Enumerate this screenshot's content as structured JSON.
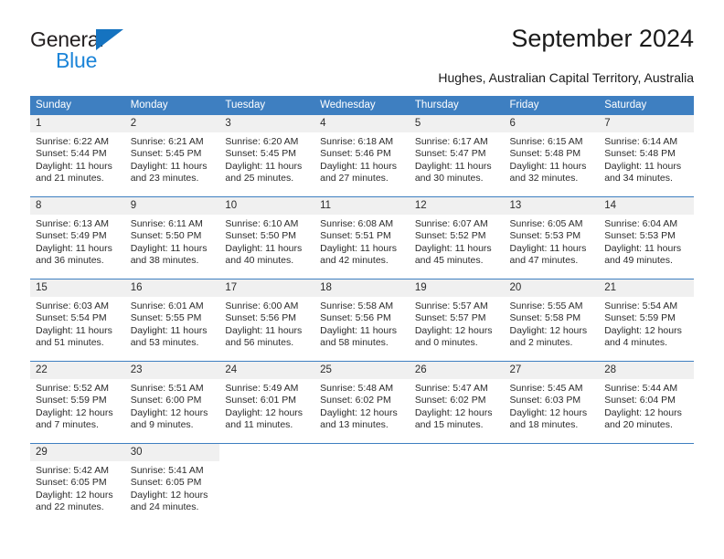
{
  "brand": {
    "name_top": "General",
    "name_bottom": "Blue",
    "triangle_color": "#1573c0",
    "text_color": "#231f20",
    "blue_text_color": "#1b84d8"
  },
  "header": {
    "title": "September 2024",
    "subtitle": "Hughes, Australian Capital Territory, Australia"
  },
  "theme": {
    "header_bg": "#3e7fc1",
    "header_text": "#ffffff",
    "daynum_bg": "#f0f0f0",
    "body_text": "#2b2b2b",
    "row_border": "#3e7fc1"
  },
  "calendar": {
    "weekday_headers": [
      "Sunday",
      "Monday",
      "Tuesday",
      "Wednesday",
      "Thursday",
      "Friday",
      "Saturday"
    ],
    "weeks": [
      [
        {
          "day": "1",
          "sunrise": "Sunrise: 6:22 AM",
          "sunset": "Sunset: 5:44 PM",
          "daylight_line1": "Daylight: 11 hours",
          "daylight_line2": "and 21 minutes."
        },
        {
          "day": "2",
          "sunrise": "Sunrise: 6:21 AM",
          "sunset": "Sunset: 5:45 PM",
          "daylight_line1": "Daylight: 11 hours",
          "daylight_line2": "and 23 minutes."
        },
        {
          "day": "3",
          "sunrise": "Sunrise: 6:20 AM",
          "sunset": "Sunset: 5:45 PM",
          "daylight_line1": "Daylight: 11 hours",
          "daylight_line2": "and 25 minutes."
        },
        {
          "day": "4",
          "sunrise": "Sunrise: 6:18 AM",
          "sunset": "Sunset: 5:46 PM",
          "daylight_line1": "Daylight: 11 hours",
          "daylight_line2": "and 27 minutes."
        },
        {
          "day": "5",
          "sunrise": "Sunrise: 6:17 AM",
          "sunset": "Sunset: 5:47 PM",
          "daylight_line1": "Daylight: 11 hours",
          "daylight_line2": "and 30 minutes."
        },
        {
          "day": "6",
          "sunrise": "Sunrise: 6:15 AM",
          "sunset": "Sunset: 5:48 PM",
          "daylight_line1": "Daylight: 11 hours",
          "daylight_line2": "and 32 minutes."
        },
        {
          "day": "7",
          "sunrise": "Sunrise: 6:14 AM",
          "sunset": "Sunset: 5:48 PM",
          "daylight_line1": "Daylight: 11 hours",
          "daylight_line2": "and 34 minutes."
        }
      ],
      [
        {
          "day": "8",
          "sunrise": "Sunrise: 6:13 AM",
          "sunset": "Sunset: 5:49 PM",
          "daylight_line1": "Daylight: 11 hours",
          "daylight_line2": "and 36 minutes."
        },
        {
          "day": "9",
          "sunrise": "Sunrise: 6:11 AM",
          "sunset": "Sunset: 5:50 PM",
          "daylight_line1": "Daylight: 11 hours",
          "daylight_line2": "and 38 minutes."
        },
        {
          "day": "10",
          "sunrise": "Sunrise: 6:10 AM",
          "sunset": "Sunset: 5:50 PM",
          "daylight_line1": "Daylight: 11 hours",
          "daylight_line2": "and 40 minutes."
        },
        {
          "day": "11",
          "sunrise": "Sunrise: 6:08 AM",
          "sunset": "Sunset: 5:51 PM",
          "daylight_line1": "Daylight: 11 hours",
          "daylight_line2": "and 42 minutes."
        },
        {
          "day": "12",
          "sunrise": "Sunrise: 6:07 AM",
          "sunset": "Sunset: 5:52 PM",
          "daylight_line1": "Daylight: 11 hours",
          "daylight_line2": "and 45 minutes."
        },
        {
          "day": "13",
          "sunrise": "Sunrise: 6:05 AM",
          "sunset": "Sunset: 5:53 PM",
          "daylight_line1": "Daylight: 11 hours",
          "daylight_line2": "and 47 minutes."
        },
        {
          "day": "14",
          "sunrise": "Sunrise: 6:04 AM",
          "sunset": "Sunset: 5:53 PM",
          "daylight_line1": "Daylight: 11 hours",
          "daylight_line2": "and 49 minutes."
        }
      ],
      [
        {
          "day": "15",
          "sunrise": "Sunrise: 6:03 AM",
          "sunset": "Sunset: 5:54 PM",
          "daylight_line1": "Daylight: 11 hours",
          "daylight_line2": "and 51 minutes."
        },
        {
          "day": "16",
          "sunrise": "Sunrise: 6:01 AM",
          "sunset": "Sunset: 5:55 PM",
          "daylight_line1": "Daylight: 11 hours",
          "daylight_line2": "and 53 minutes."
        },
        {
          "day": "17",
          "sunrise": "Sunrise: 6:00 AM",
          "sunset": "Sunset: 5:56 PM",
          "daylight_line1": "Daylight: 11 hours",
          "daylight_line2": "and 56 minutes."
        },
        {
          "day": "18",
          "sunrise": "Sunrise: 5:58 AM",
          "sunset": "Sunset: 5:56 PM",
          "daylight_line1": "Daylight: 11 hours",
          "daylight_line2": "and 58 minutes."
        },
        {
          "day": "19",
          "sunrise": "Sunrise: 5:57 AM",
          "sunset": "Sunset: 5:57 PM",
          "daylight_line1": "Daylight: 12 hours",
          "daylight_line2": "and 0 minutes."
        },
        {
          "day": "20",
          "sunrise": "Sunrise: 5:55 AM",
          "sunset": "Sunset: 5:58 PM",
          "daylight_line1": "Daylight: 12 hours",
          "daylight_line2": "and 2 minutes."
        },
        {
          "day": "21",
          "sunrise": "Sunrise: 5:54 AM",
          "sunset": "Sunset: 5:59 PM",
          "daylight_line1": "Daylight: 12 hours",
          "daylight_line2": "and 4 minutes."
        }
      ],
      [
        {
          "day": "22",
          "sunrise": "Sunrise: 5:52 AM",
          "sunset": "Sunset: 5:59 PM",
          "daylight_line1": "Daylight: 12 hours",
          "daylight_line2": "and 7 minutes."
        },
        {
          "day": "23",
          "sunrise": "Sunrise: 5:51 AM",
          "sunset": "Sunset: 6:00 PM",
          "daylight_line1": "Daylight: 12 hours",
          "daylight_line2": "and 9 minutes."
        },
        {
          "day": "24",
          "sunrise": "Sunrise: 5:49 AM",
          "sunset": "Sunset: 6:01 PM",
          "daylight_line1": "Daylight: 12 hours",
          "daylight_line2": "and 11 minutes."
        },
        {
          "day": "25",
          "sunrise": "Sunrise: 5:48 AM",
          "sunset": "Sunset: 6:02 PM",
          "daylight_line1": "Daylight: 12 hours",
          "daylight_line2": "and 13 minutes."
        },
        {
          "day": "26",
          "sunrise": "Sunrise: 5:47 AM",
          "sunset": "Sunset: 6:02 PM",
          "daylight_line1": "Daylight: 12 hours",
          "daylight_line2": "and 15 minutes."
        },
        {
          "day": "27",
          "sunrise": "Sunrise: 5:45 AM",
          "sunset": "Sunset: 6:03 PM",
          "daylight_line1": "Daylight: 12 hours",
          "daylight_line2": "and 18 minutes."
        },
        {
          "day": "28",
          "sunrise": "Sunrise: 5:44 AM",
          "sunset": "Sunset: 6:04 PM",
          "daylight_line1": "Daylight: 12 hours",
          "daylight_line2": "and 20 minutes."
        }
      ],
      [
        {
          "day": "29",
          "sunrise": "Sunrise: 5:42 AM",
          "sunset": "Sunset: 6:05 PM",
          "daylight_line1": "Daylight: 12 hours",
          "daylight_line2": "and 22 minutes."
        },
        {
          "day": "30",
          "sunrise": "Sunrise: 5:41 AM",
          "sunset": "Sunset: 6:05 PM",
          "daylight_line1": "Daylight: 12 hours",
          "daylight_line2": "and 24 minutes."
        },
        {
          "day": "",
          "sunrise": "",
          "sunset": "",
          "daylight_line1": "",
          "daylight_line2": ""
        },
        {
          "day": "",
          "sunrise": "",
          "sunset": "",
          "daylight_line1": "",
          "daylight_line2": ""
        },
        {
          "day": "",
          "sunrise": "",
          "sunset": "",
          "daylight_line1": "",
          "daylight_line2": ""
        },
        {
          "day": "",
          "sunrise": "",
          "sunset": "",
          "daylight_line1": "",
          "daylight_line2": ""
        },
        {
          "day": "",
          "sunrise": "",
          "sunset": "",
          "daylight_line1": "",
          "daylight_line2": ""
        }
      ]
    ]
  }
}
